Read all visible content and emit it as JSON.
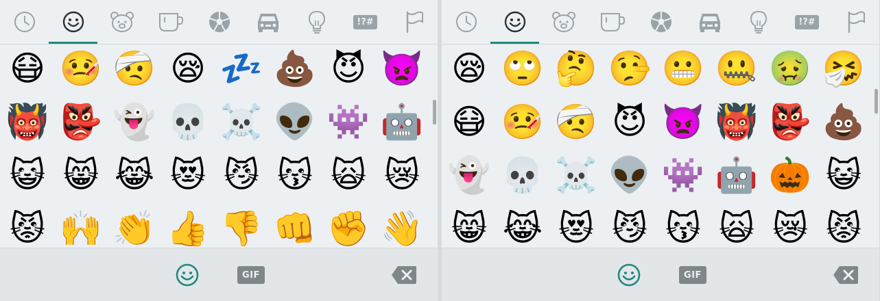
{
  "colors": {
    "background": "#ecf0f3",
    "bottom_bar": "#e2e6e9",
    "icon_gray": "#9aa3a8",
    "active_tab_icon": "#2c3034",
    "indicator": "#1f8a7c",
    "active_emoji_button": "#1f8a7c",
    "gif_badge": "#7f878b",
    "backspace": "#7f878b"
  },
  "tabs": [
    {
      "name": "recent",
      "icon": "clock-icon"
    },
    {
      "name": "smileys",
      "icon": "smiley-icon"
    },
    {
      "name": "animals",
      "icon": "bear-icon"
    },
    {
      "name": "food",
      "icon": "cup-icon"
    },
    {
      "name": "activities",
      "icon": "soccer-ball-icon"
    },
    {
      "name": "travel",
      "icon": "car-icon"
    },
    {
      "name": "objects",
      "icon": "lightbulb-icon"
    },
    {
      "name": "symbols",
      "icon": "symbols-icon",
      "label": "!?#"
    },
    {
      "name": "flags",
      "icon": "flag-icon"
    }
  ],
  "left_panel": {
    "active_tab": 1,
    "emoji_rows": [
      [
        "😷",
        "🤒",
        "🤕",
        "😪",
        "💤",
        "💩",
        "😈",
        "👿"
      ],
      [
        "👹",
        "👺",
        "👻",
        "💀",
        "☠️",
        "👽",
        "👾",
        "🤖"
      ],
      [
        "😺",
        "😸",
        "😹",
        "😻",
        "😼",
        "😽",
        "🙀",
        "😿"
      ],
      [
        "😾",
        "🙌",
        "👏",
        "👍",
        "👎",
        "👊",
        "✊",
        "👋"
      ]
    ]
  },
  "right_panel": {
    "active_tab": 1,
    "emoji_rows": [
      [
        "😪",
        "🙄",
        "🤔",
        "🤥",
        "😬",
        "🤐",
        "🤢",
        "🤧"
      ],
      [
        "😷",
        "🤒",
        "🤕",
        "😈",
        "👿",
        "👹",
        "👺",
        "💩"
      ],
      [
        "👻",
        "💀",
        "☠️",
        "👽",
        "👾",
        "🤖",
        "🎃",
        "😺"
      ],
      [
        "😸",
        "😹",
        "😻",
        "😼",
        "😽",
        "🙀",
        "😿",
        "😾"
      ]
    ]
  },
  "bottom_bar": {
    "emoji_button_icon": "smiley-icon",
    "gif_label": "GIF",
    "backspace_icon": "backspace-icon"
  }
}
